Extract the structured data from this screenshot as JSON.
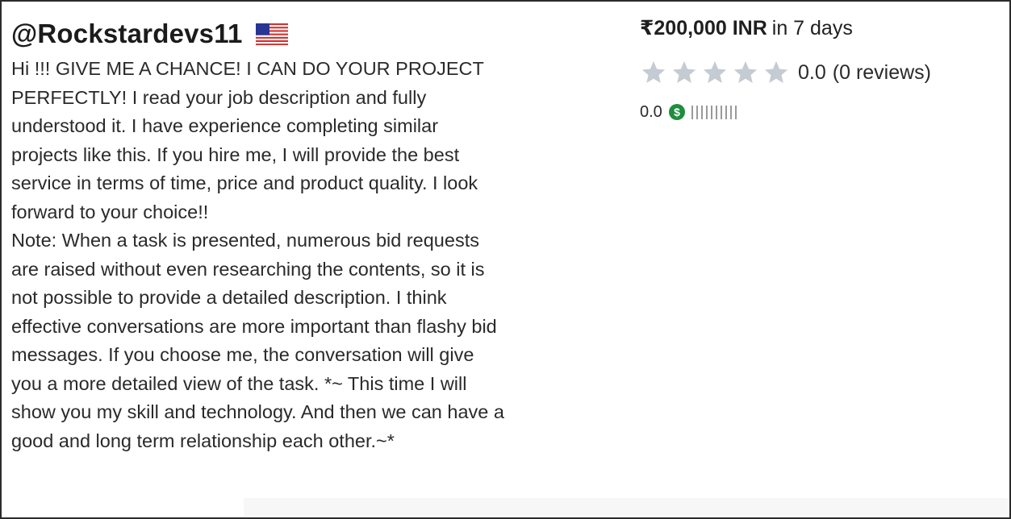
{
  "bidder": {
    "handle": "@Rockstardevs11",
    "country_flag": "us-flag-icon",
    "text": "Hi !!! GIVE ME A CHANCE! I CAN DO YOUR PROJECT\nPERFECTLY! I read your job description and fully\nunderstood it. I have experience completing similar\nprojects like this. If you hire me, I will provide the best\nservice in terms of time, price and product quality. I look\nforward to your choice!!\nNote: When a task is presented, numerous bid requests\nare raised without even researching the contents, so it is\nnot possible to provide a detailed description. I think\neffective conversations are more important than flashy bid\nmessages. If you choose me, the conversation will give\nyou a more detailed view of the task. *~ This time I will\nshow you my skill and technology. And then we can have a\ngood and long term relationship each other.~*"
  },
  "bid": {
    "amount": "₹200,000 INR",
    "duration": "in 7 days"
  },
  "rating": {
    "stars_filled": 0,
    "stars_total": 5,
    "score": "0.0",
    "reviews": "(0 reviews)"
  },
  "earnings": {
    "score": "0.0",
    "icon": "dollar-icon",
    "bar_count": 10
  },
  "colors": {
    "star_empty": "#c5cbd3",
    "dollar_green": "#1e8e3e",
    "bars": "#9a9a9a",
    "border": "#2b2b2b"
  }
}
